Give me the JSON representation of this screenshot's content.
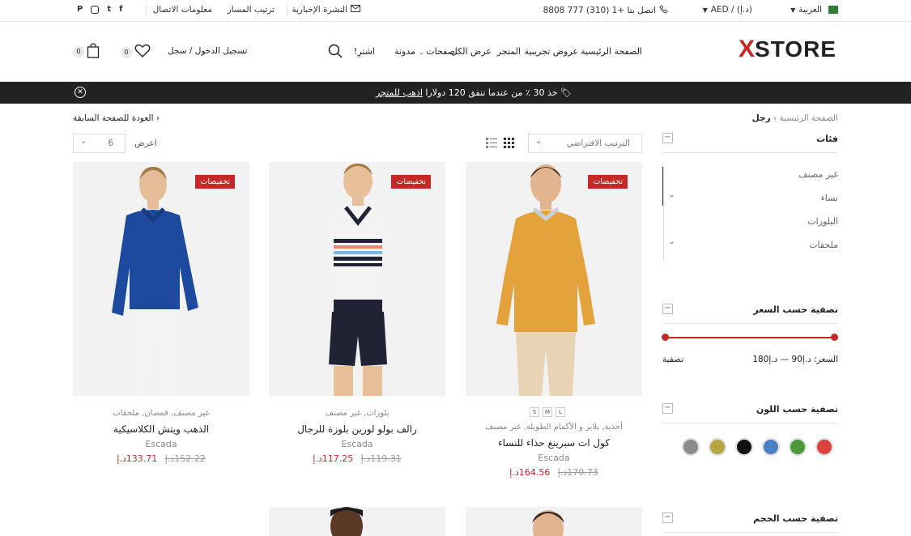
{
  "topbar": {
    "language": "العربية",
    "currency": "AED / (د.إ)",
    "phone": "اتصل بنا +1 (310) 777 8808",
    "newsletter": "النشرة الإخبارية",
    "track_order": "ترتيب المسار",
    "contact_info": "معلومات الاتصال",
    "social_icons": [
      "facebook-icon",
      "twitter-icon",
      "instagram-icon",
      "pinterest-icon"
    ]
  },
  "header": {
    "logo_mark": "X",
    "logo_text": "STORE",
    "nav": [
      "الصفحة الرئيسية",
      "عروض تجريبية",
      "المتجر",
      "عرض الكل",
      "صفحات",
      "مدونة",
      "اشترِ!"
    ],
    "login": "تسجيل الدخول / سجل",
    "wishlist_count": "0",
    "cart_count": "0"
  },
  "promo": {
    "text": "خذ 30 ٪ من عندما تنفق 120 دولارا",
    "link": "اذهب للمتجر"
  },
  "breadcrumb": {
    "home": "الصفحة الرئيسية",
    "current": "رجل",
    "back": "العودة للصفحة السابقة"
  },
  "toolbar": {
    "sort": "الترتيب الافتراضي",
    "show_label": "اعرض",
    "show_value": "6"
  },
  "sidebar": {
    "categories_title": "فئات",
    "categories": [
      "غير مصنف",
      "نساء",
      "البلوزات",
      "ملحقات"
    ],
    "price_title": "تصفية حسب السعر",
    "price_text": "السعر: د.إ90 — د.إ180",
    "filter_button": "تصفية",
    "color_title": "تصفية حسب اللون",
    "colors": [
      "#d9433b",
      "#4e9a3a",
      "#4a7fc4",
      "#111111",
      "#b5a642",
      "#8c8c8c"
    ],
    "size_title": "تصفية حسب الحجم"
  },
  "products": [
    {
      "badge": "تخفيضات",
      "sizes": [
        "L",
        "M",
        "S"
      ],
      "category": "أحذية, بلايز و الأكمام الطويلة, غير مصنف",
      "title": "كول ات سبرينغ حذاء للنساء",
      "brand": "Escada",
      "old_price": "170.73د.إ",
      "new_price": "164.56د.إ"
    },
    {
      "badge": "تخفيضات",
      "category": "بلوزات, غير مصنف",
      "title": "رالف بولو لورين بلوزة للرجال",
      "brand": "Escada",
      "old_price": "119.31د.إ",
      "new_price": "117.25د.إ"
    },
    {
      "badge": "تخفيضات",
      "category": "غير مصنف, قمصان, ملحقات",
      "title": "الذهب ويتش الكلاسيكية",
      "brand": "Escada",
      "old_price": "152.22د.إ",
      "new_price": "133.71د.إ"
    }
  ]
}
